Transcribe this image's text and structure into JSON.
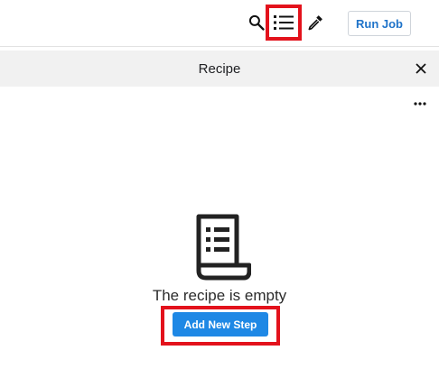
{
  "toolbar": {
    "search_icon": "search-icon",
    "list_icon": "list-icon",
    "picker_icon": "eyedropper-icon",
    "run_job_label": "Run Job"
  },
  "panel": {
    "title": "Recipe",
    "close_icon": "close-icon",
    "more_icon": "more-horizontal-icon"
  },
  "empty_state": {
    "icon": "recipe-document-icon",
    "message": "The recipe is empty",
    "button_label": "Add New Step"
  },
  "colors": {
    "accent": "#1e88e5",
    "run_job_text": "#1f73c9",
    "highlight": "#e3121c",
    "header_bg": "#f1f1f1"
  }
}
